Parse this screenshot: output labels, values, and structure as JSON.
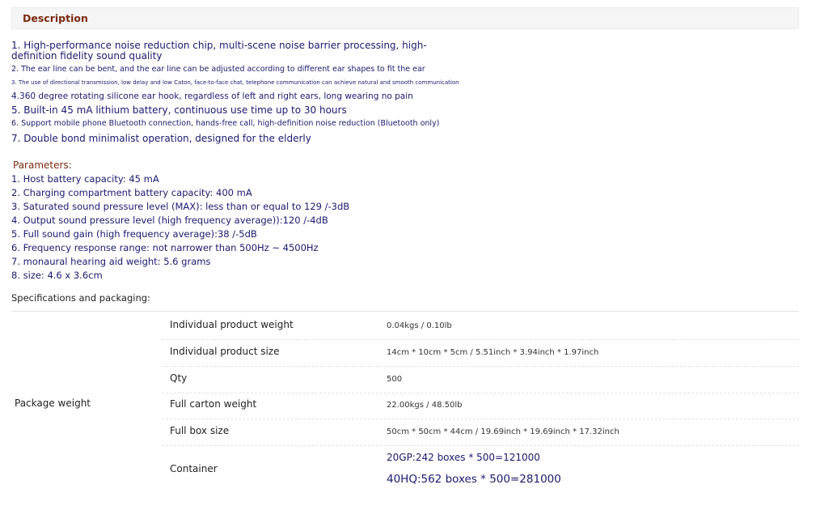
{
  "description": {
    "title": "Description",
    "features": [
      "1. High-performance noise reduction chip, multi-scene noise barrier processing, high-",
      "definition fidelity sound quality",
      "2. The ear line can be bent, and the ear line can be adjusted according to different ear shapes to fit the ear",
      "3. The use of directional transmission, low delay and low Caton, face-to-face chat, telephone communication can achieve natural and smooth communication",
      "4.360 degree rotating silicone ear hook, regardless of left and right ears, long wearing no pain",
      "5. Built-in 45 mA lithium battery, continuous use time up to 30 hours",
      "6. Support mobile phone Bluetooth connection, hands-free call, high-definition noise reduction (Bluetooth only)",
      "7. Double bond minimalist operation, designed for the elderly"
    ]
  },
  "parameters": {
    "title": "Parameters:",
    "items": [
      "1. Host battery capacity: 45 mA",
      "2. Charging compartment battery capacity: 400 mA",
      "3. Saturated sound pressure level (MAX): less than or equal to 129 /-3dB",
      "4. Output sound pressure level (high frequency average)):120 /-4dB",
      "5. Full sound gain (high frequency average):38 /-5dB",
      "6. Frequency response range: not narrower than 500Hz ~ 4500Hz",
      "7. monaural hearing aid weight: 5.6 grams",
      "8. size: 4.6 x 3.6cm"
    ]
  },
  "specs": {
    "title": "Specifications and packaging:",
    "group_label": "Package weight",
    "rows": [
      {
        "label": "Individual product weight",
        "value": "0.04kgs / 0.10lb"
      },
      {
        "label": "Individual product size",
        "value": "14cm * 10cm * 5cm / 5.51inch * 3.94inch * 1.97inch"
      },
      {
        "label": "Qty",
        "value": "500"
      },
      {
        "label": "Full carton weight",
        "value": "22.00kgs / 48.50lb"
      },
      {
        "label": "Full box size",
        "value": "50cm * 50cm * 44cm / 19.69inch * 19.69inch * 17.32inch"
      },
      {
        "label": "Container",
        "values": [
          "20GP:242 boxes * 500=121000",
          "40HQ:562 boxes * 500=281000"
        ]
      }
    ]
  }
}
